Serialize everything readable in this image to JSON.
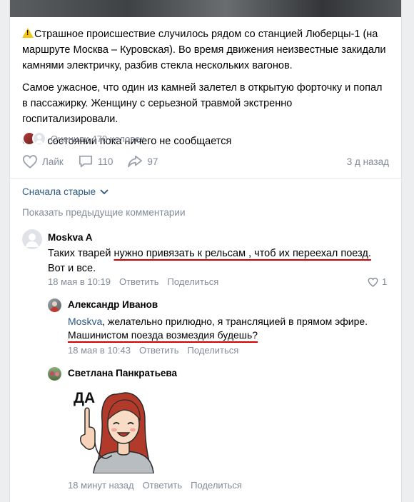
{
  "post": {
    "paragraphs": [
      "Страшное происшествие случилось рядом со станцией Люберцы-1 (на маршруте Москва – Куровская). Во время движения неизвестные закидали камнями электричку, разбив стекла нескольких вагонов.",
      "Самое ужасное, что один из камней залетел в открытую форточку и попал в пассажирку. Женщину с серьезной травмой экстренно госпитализировали.",
      "О ее состоянии пока ничего не сообщается"
    ],
    "rated": "Оценили 470 человек",
    "like_label": "Лайк",
    "comments_count": "110",
    "shares_count": "97",
    "date": "3 д назад"
  },
  "comments_bar": {
    "sort_label": "Сначала старые",
    "show_previous": "Показать предыдущие комментарии"
  },
  "comments": [
    {
      "author": "Moskva A",
      "text_before": "Таких тварей ",
      "text_underlined": "нужно привязать к рельсам , чтоб их переехал поезд.",
      "text_after": " Вот и все.",
      "date": "18 мая в 10:19",
      "reply": "Ответить",
      "share": "Поделиться",
      "likes": "1"
    },
    {
      "author": "Александр Иванов",
      "mention": "Moskva",
      "text_line1": ", желательно прилюдно, я трансляцией в прямом эфире.",
      "text_underlined": "Машинистом поезда возмездия будешь?",
      "date": "18 мая в 10:43",
      "reply": "Ответить",
      "share": "Поделиться"
    },
    {
      "author": "Светлана Панкратьева",
      "sticker_text": "ДА",
      "date": "18 минут назад",
      "reply": "Ответить",
      "share": "Поделиться"
    }
  ],
  "colors": {
    "link": "#2a5885",
    "muted": "#818c99",
    "underline": "#d40000"
  }
}
